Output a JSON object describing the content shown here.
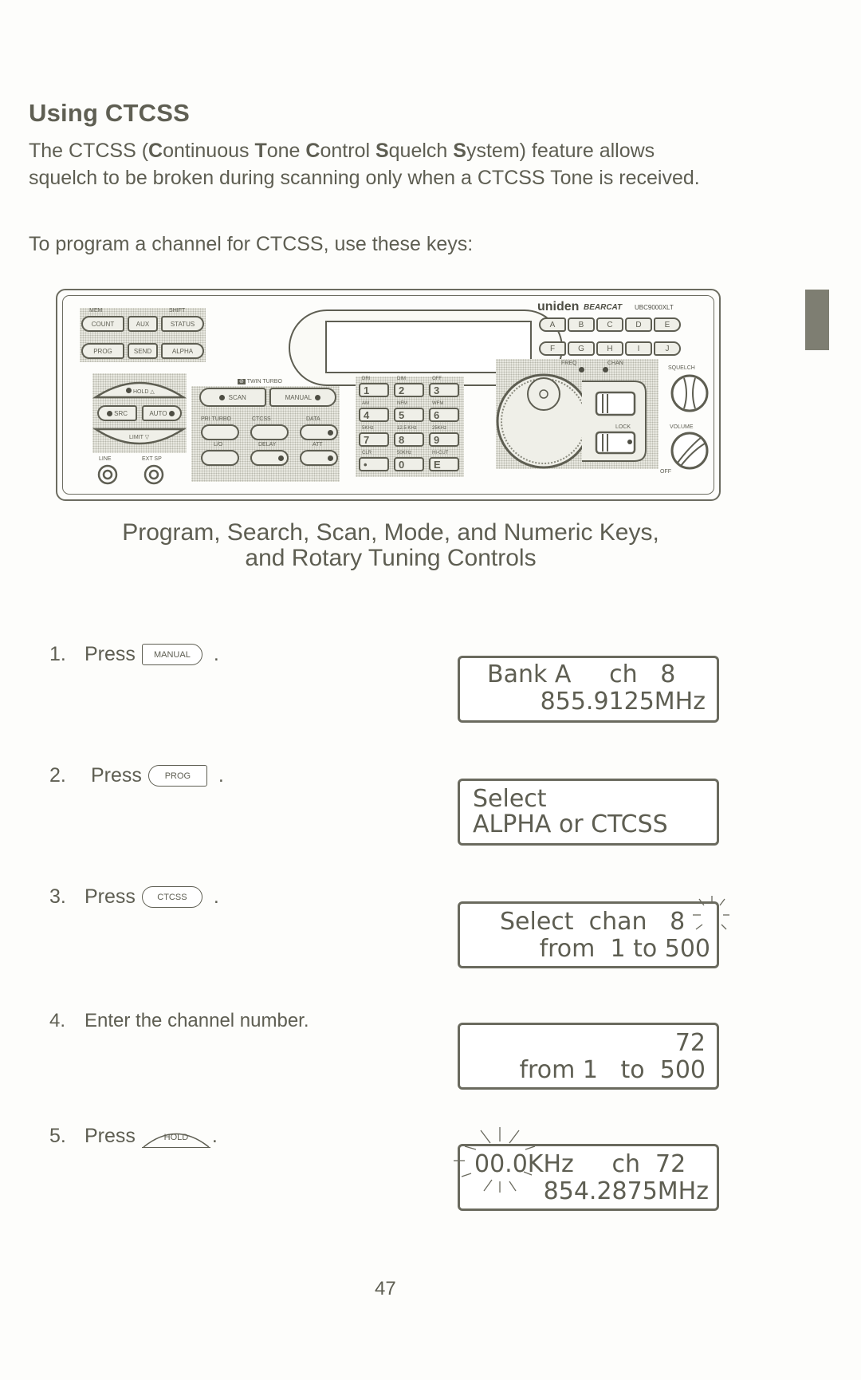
{
  "page": {
    "title": "Using CTCSS",
    "intro_parts": [
      {
        "t": "The CTCSS (",
        "b": false
      },
      {
        "t": "C",
        "b": true
      },
      {
        "t": "ontinuous ",
        "b": false
      },
      {
        "t": "T",
        "b": true
      },
      {
        "t": "one ",
        "b": false
      },
      {
        "t": "C",
        "b": true
      },
      {
        "t": "ontrol ",
        "b": false
      },
      {
        "t": "S",
        "b": true
      },
      {
        "t": "quelch ",
        "b": false
      },
      {
        "t": "S",
        "b": true
      },
      {
        "t": "ystem) feature allows squelch to be broken during scanning only when a CTCSS Tone is received.",
        "b": false
      }
    ],
    "keys_line": "To program a channel for CTCSS, use these keys:",
    "caption_line1": "Program, Search, Scan, Mode, and Numeric Keys,",
    "caption_line2": "and Rotary Tuning Controls",
    "page_number": "47"
  },
  "scanner": {
    "brand": "uniden",
    "brand_sub": "BEARCAT",
    "model": "UBC9000XLT",
    "top_labels": {
      "mem": "MEM",
      "shift": "SHIFT"
    },
    "left_keys_row1": [
      "COUNT",
      "AUX",
      "STATUS"
    ],
    "left_keys_row2": [
      "PROG",
      "SEND",
      "ALPHA"
    ],
    "hold_key": "HOLD",
    "src_key": "SRC",
    "auto_key": "AUTO",
    "limit_key": "LIMIT",
    "jacks": [
      "LINE",
      "EXT SP"
    ],
    "twin_turbo": "TWIN TURBO",
    "scan_key": "SCAN",
    "manual_key": "MANUAL",
    "mode_labels_top": [
      "PRI TURBO",
      "CTCSS",
      "DATA"
    ],
    "mode_labels_bottom": [
      "L/O",
      "DELAY",
      "ATT"
    ],
    "numpad": [
      {
        "key": "1",
        "label": "DRI"
      },
      {
        "key": "2",
        "label": "DIM"
      },
      {
        "key": "3",
        "label": "OFF"
      },
      {
        "key": "4",
        "label": "AM"
      },
      {
        "key": "5",
        "label": "NFM"
      },
      {
        "key": "6",
        "label": "WFM"
      },
      {
        "key": "7",
        "label": "5KHz"
      },
      {
        "key": "8",
        "label": "12.5 KHz"
      },
      {
        "key": "9",
        "label": "25KHz"
      },
      {
        "key": "•",
        "label": "CLR"
      },
      {
        "key": "0",
        "label": "50KHz"
      },
      {
        "key": "E",
        "label": "HI-CUT"
      }
    ],
    "bank_row1": [
      "A",
      "B",
      "C",
      "D",
      "E"
    ],
    "bank_row2": [
      "F",
      "G",
      "H",
      "I",
      "J"
    ],
    "freq_label": "FREQ",
    "chan_label": "CHAN",
    "lock_label": "LOCK",
    "squelch_label": "SQUELCH",
    "volume_label": "VOLUME",
    "off_label": "OFF"
  },
  "steps": [
    {
      "num": "1.",
      "word": "Press",
      "key": "MANUAL",
      "suffix": "."
    },
    {
      "num": "2.",
      "word": "Press",
      "key": "PROG",
      "suffix": "."
    },
    {
      "num": "3.",
      "word": "Press",
      "key": "CTCSS",
      "suffix": "."
    },
    {
      "num": "4.",
      "text": "Enter the channel number."
    },
    {
      "num": "5.",
      "word": "Press",
      "key": "HOLD",
      "suffix": "."
    }
  ],
  "displays": [
    {
      "line1": "Bank A     ch   8",
      "line2": "855.9125MHz"
    },
    {
      "line1": "Select",
      "line2": "ALPHA or CTCSS"
    },
    {
      "line1": "Select  chan   8",
      "line2": "from  1 to 500",
      "blinking": "8"
    },
    {
      "line1": "72",
      "line2": "from 1   to  500"
    },
    {
      "line1": "00.0KHz     ch  72",
      "line2": "854.2875MHz",
      "blinking": "00.0KHz"
    }
  ]
}
